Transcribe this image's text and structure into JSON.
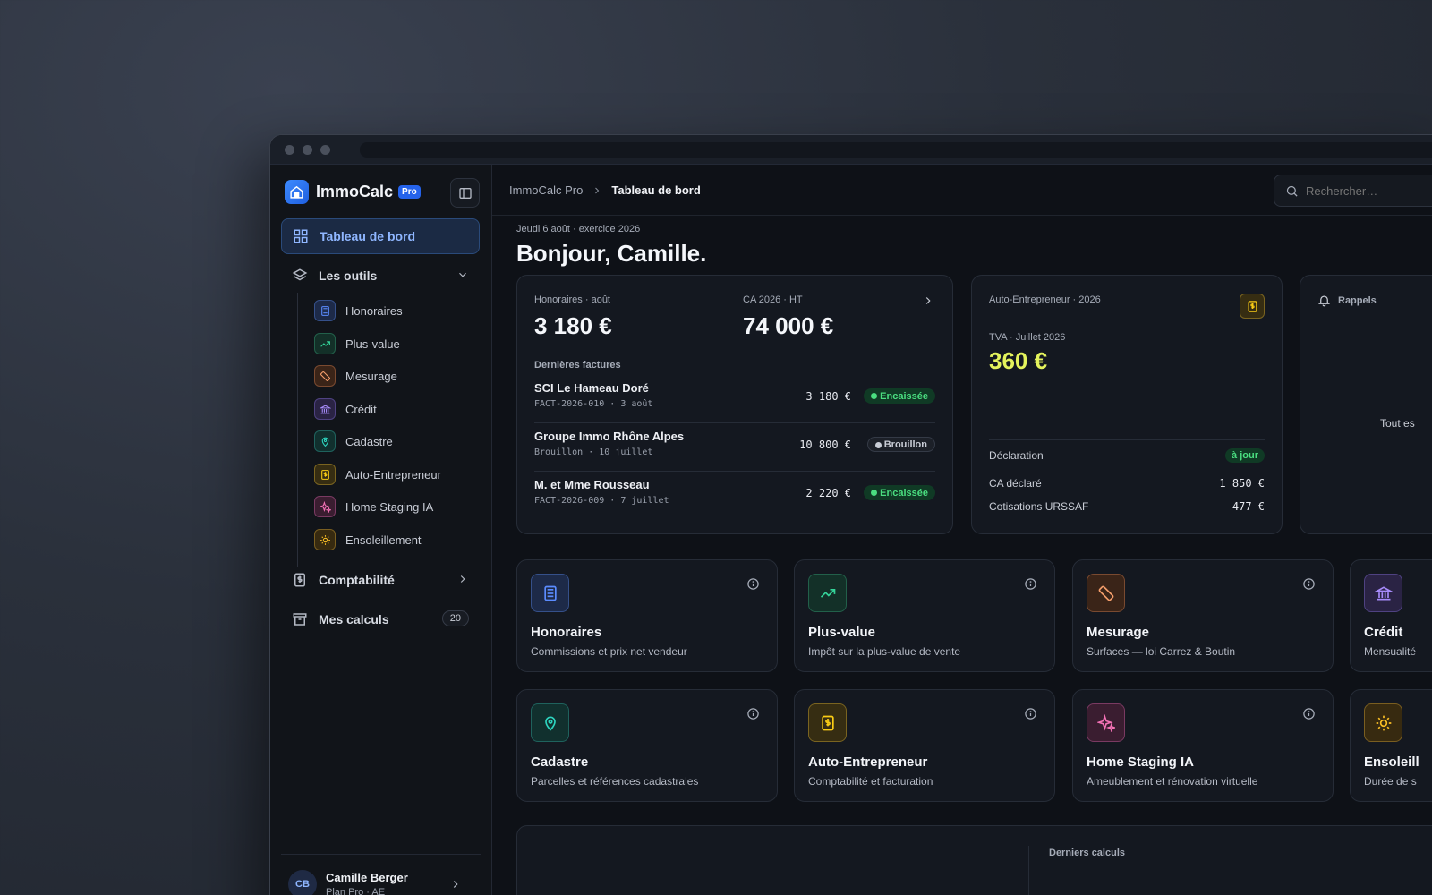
{
  "app": {
    "name": "ImmoCalc",
    "plan_badge": "Pro"
  },
  "sidebar": {
    "main_item": "Tableau de bord",
    "tools_group": "Les outils",
    "tools": [
      {
        "label": "Honoraires",
        "icon": "calculator-icon",
        "color": "#5b8cff"
      },
      {
        "label": "Plus-value",
        "icon": "trending-up-icon",
        "color": "#34d399"
      },
      {
        "label": "Mesurage",
        "icon": "ruler-icon",
        "color": "#f59e6b"
      },
      {
        "label": "Crédit",
        "icon": "bank-icon",
        "color": "#a78bfa"
      },
      {
        "label": "Cadastre",
        "icon": "map-pin-icon",
        "color": "#2dd4bf"
      },
      {
        "label": "Auto-Entrepreneur",
        "icon": "dollar-doc-icon",
        "color": "#facc15"
      },
      {
        "label": "Home Staging IA",
        "icon": "sparkles-icon",
        "color": "#f472b6"
      },
      {
        "label": "Ensoleillement",
        "icon": "sun-icon",
        "color": "#fbbf24"
      }
    ],
    "accounting": "Comptabilité",
    "calculations": "Mes calculs",
    "calculations_count": "20",
    "user": {
      "initials": "CB",
      "name": "Camille Berger",
      "plan": "Plan Pro · AE"
    }
  },
  "topbar": {
    "breadcrumb_root": "ImmoCalc Pro",
    "breadcrumb_current": "Tableau de bord",
    "search_placeholder": "Rechercher…"
  },
  "dashboard": {
    "date_line": "Jeudi 6 août · exercice 2026",
    "greeting": "Bonjour, Camille.",
    "fees": {
      "label": "Honoraires · août",
      "value": "3 180 €",
      "ca_label": "CA 2026 · HT",
      "ca_value": "74 000 €",
      "invoices_title": "Dernières factures",
      "invoices": [
        {
          "name": "SCI Le Hameau Doré",
          "meta": "FACT-2026-010 · 3 août",
          "amount": "3 180 €",
          "status": "Encaissée",
          "state": "ok"
        },
        {
          "name": "Groupe Immo Rhône Alpes",
          "meta": "Brouillon · 10 juillet",
          "amount": "10 800 €",
          "status": "Brouillon",
          "state": "draft"
        },
        {
          "name": "M. et Mme Rousseau",
          "meta": "FACT-2026-009 · 7 juillet",
          "amount": "2 220 €",
          "status": "Encaissée",
          "state": "ok"
        }
      ]
    },
    "ae": {
      "label": "Auto-Entrepreneur · 2026",
      "tva_label": "TVA · Juillet 2026",
      "tva_value": "360 €",
      "declaration_label": "Déclaration",
      "declaration_status": "à jour",
      "ca_declared_label": "CA déclaré",
      "ca_declared_value": "1 850 €",
      "urssaf_label": "Cotisations URSSAF",
      "urssaf_value": "477 €"
    },
    "reminders": {
      "label": "Rappels",
      "empty_text": "Tout es"
    },
    "tool_cards": [
      {
        "title": "Honoraires",
        "desc": "Commissions et prix net vendeur",
        "icon": "calculator-icon",
        "color": "#5b8cff"
      },
      {
        "title": "Plus-value",
        "desc": "Impôt sur la plus-value de vente",
        "icon": "trending-up-icon",
        "color": "#34d399"
      },
      {
        "title": "Mesurage",
        "desc": "Surfaces — loi Carrez & Boutin",
        "icon": "ruler-icon",
        "color": "#f59e6b"
      },
      {
        "title": "Crédit",
        "desc": "Mensualité",
        "icon": "bank-icon",
        "color": "#a78bfa"
      },
      {
        "title": "Cadastre",
        "desc": "Parcelles et références cadastrales",
        "icon": "map-pin-icon",
        "color": "#2dd4bf"
      },
      {
        "title": "Auto-Entrepreneur",
        "desc": "Comptabilité et facturation",
        "icon": "dollar-doc-icon",
        "color": "#facc15"
      },
      {
        "title": "Home Staging IA",
        "desc": "Ameublement et rénovation virtuelle",
        "icon": "sparkles-icon",
        "color": "#f472b6"
      },
      {
        "title": "Ensoleill",
        "desc": "Durée de s",
        "icon": "sun-icon",
        "color": "#fbbf24"
      }
    ],
    "recent_calcs_label": "Derniers calculs"
  }
}
